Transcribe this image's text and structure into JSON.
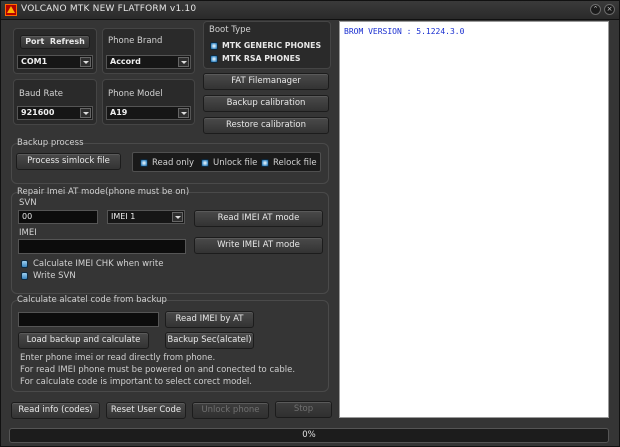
{
  "window": {
    "title": "VOLCANO MTK NEW FLATFORM v1.10",
    "buttons": [
      "chevron",
      "close"
    ]
  },
  "port_panel": {
    "port_label": "Port",
    "refresh_label": "Refresh",
    "port_value": "COM1"
  },
  "brand_panel": {
    "label": "Phone  Brand",
    "value": "Accord"
  },
  "baud_panel": {
    "label": "Baud Rate",
    "value": "921600"
  },
  "model_panel": {
    "label": "Phone  Model",
    "value": "A19"
  },
  "boot_type": {
    "label": "Boot Type",
    "options": [
      "MTK GENERIC PHONES",
      "MTK RSA PHONES"
    ]
  },
  "tools": {
    "fat": "FAT Filemanager",
    "backup": "Backup calibration",
    "restore": "Restore calibration"
  },
  "backup_process": {
    "label": "Backup process",
    "button": "Process simlock file",
    "options": [
      "Read only",
      "Unlock file",
      "Relock file"
    ]
  },
  "imei": {
    "label": "Repair Imei AT mode(phone must be on)",
    "svn_label": "SVN",
    "svn_value": "00",
    "imei_select": "IMEI 1",
    "read_button": "Read IMEI AT mode",
    "imei_label": "IMEI",
    "imei_value": "",
    "write_button": "Write IMEI AT mode",
    "calc_chk": "Calculate IMEI CHK when write",
    "write_svn": "Write SVN"
  },
  "alcatel": {
    "label": "Calculate alcatel code from backup",
    "input_value": "",
    "read_imei_button": "Read IMEI by AT",
    "load_button": "Load backup and calculate",
    "backup_sec_button": "Backup Sec(alcatel)",
    "info": [
      "Enter phone imei or read directly from phone.",
      "For read IMEI phone must be powered on and conected to cable.",
      "For calculate code is important to select corect model."
    ]
  },
  "bottom": {
    "read_info": "Read info (codes)",
    "reset_user": "Reset User Code",
    "unlock_phone": "Unlock phone",
    "stop": "Stop"
  },
  "log": {
    "text": "BROM VERSION : 5.1224.3.0"
  },
  "progress": {
    "text": "0%",
    "value": 0
  }
}
